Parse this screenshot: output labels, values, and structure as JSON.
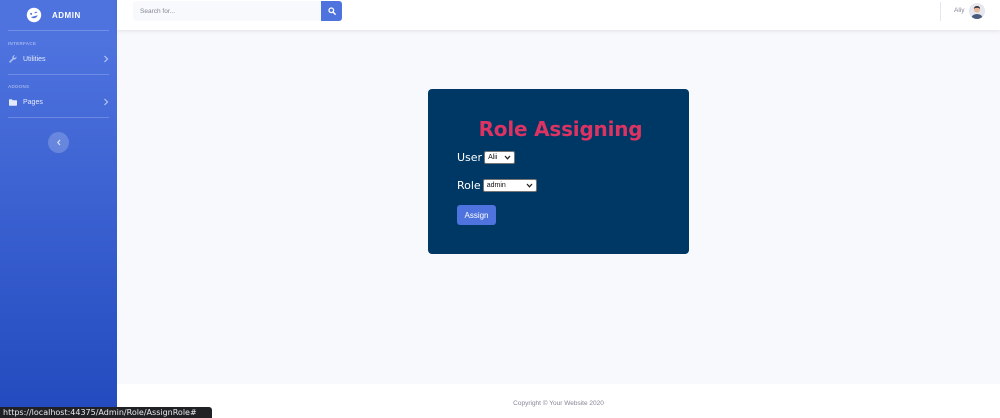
{
  "sidebar": {
    "brand": "ADMIN",
    "headings": {
      "interface": "INTERFACE",
      "addons": "ADDONS"
    },
    "items": [
      {
        "label": "Utilities",
        "icon": "wrench-icon"
      },
      {
        "label": "Pages",
        "icon": "folder-icon"
      }
    ]
  },
  "topbar": {
    "search_placeholder": "Search for...",
    "username": "Aliy"
  },
  "card": {
    "title": "Role Assigning",
    "user_label": "User",
    "user_value": "Alii",
    "role_label": "Role",
    "role_value": "admin",
    "assign_label": "Assign"
  },
  "footer": {
    "copyright": "Copyright © Your Website 2020"
  },
  "status_url": "https://localhost:44375/Admin/Role/AssignRole#",
  "colors": {
    "sidebar_top": "#4e73df",
    "sidebar_bottom": "#224abe",
    "card_bg": "#003865",
    "title": "#dc3363",
    "button": "#4e73df"
  }
}
